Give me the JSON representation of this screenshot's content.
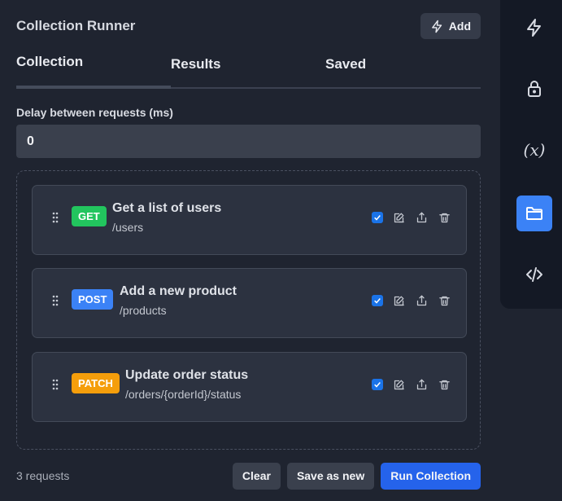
{
  "header": {
    "title": "Collection Runner",
    "add_label": "Add"
  },
  "tabs": [
    {
      "label": "Collection",
      "active": true
    },
    {
      "label": "Results",
      "active": false
    },
    {
      "label": "Saved",
      "active": false
    }
  ],
  "delay": {
    "label": "Delay between requests (ms)",
    "value": "0"
  },
  "requests": [
    {
      "method": "GET",
      "name": "Get a list of users",
      "path": "/users",
      "checked": true
    },
    {
      "method": "POST",
      "name": "Add a new product",
      "path": "/products",
      "checked": true
    },
    {
      "method": "PATCH",
      "name": "Update order status",
      "path": "/orders/{orderId}/status",
      "checked": true
    }
  ],
  "footer": {
    "count": "3 requests",
    "clear_label": "Clear",
    "save_label": "Save as new",
    "run_label": "Run Collection"
  },
  "sidebar": {
    "items": [
      {
        "icon": "lightning-icon",
        "active": false
      },
      {
        "icon": "lock-icon",
        "active": false
      },
      {
        "icon": "variables-icon",
        "text": "(x)",
        "active": false
      },
      {
        "icon": "folder-icon",
        "active": true
      },
      {
        "icon": "code-icon",
        "active": false
      }
    ]
  },
  "colors": {
    "get": "#22c55e",
    "post": "#3b82f6",
    "patch": "#f59e0b",
    "primary": "#2563eb"
  }
}
